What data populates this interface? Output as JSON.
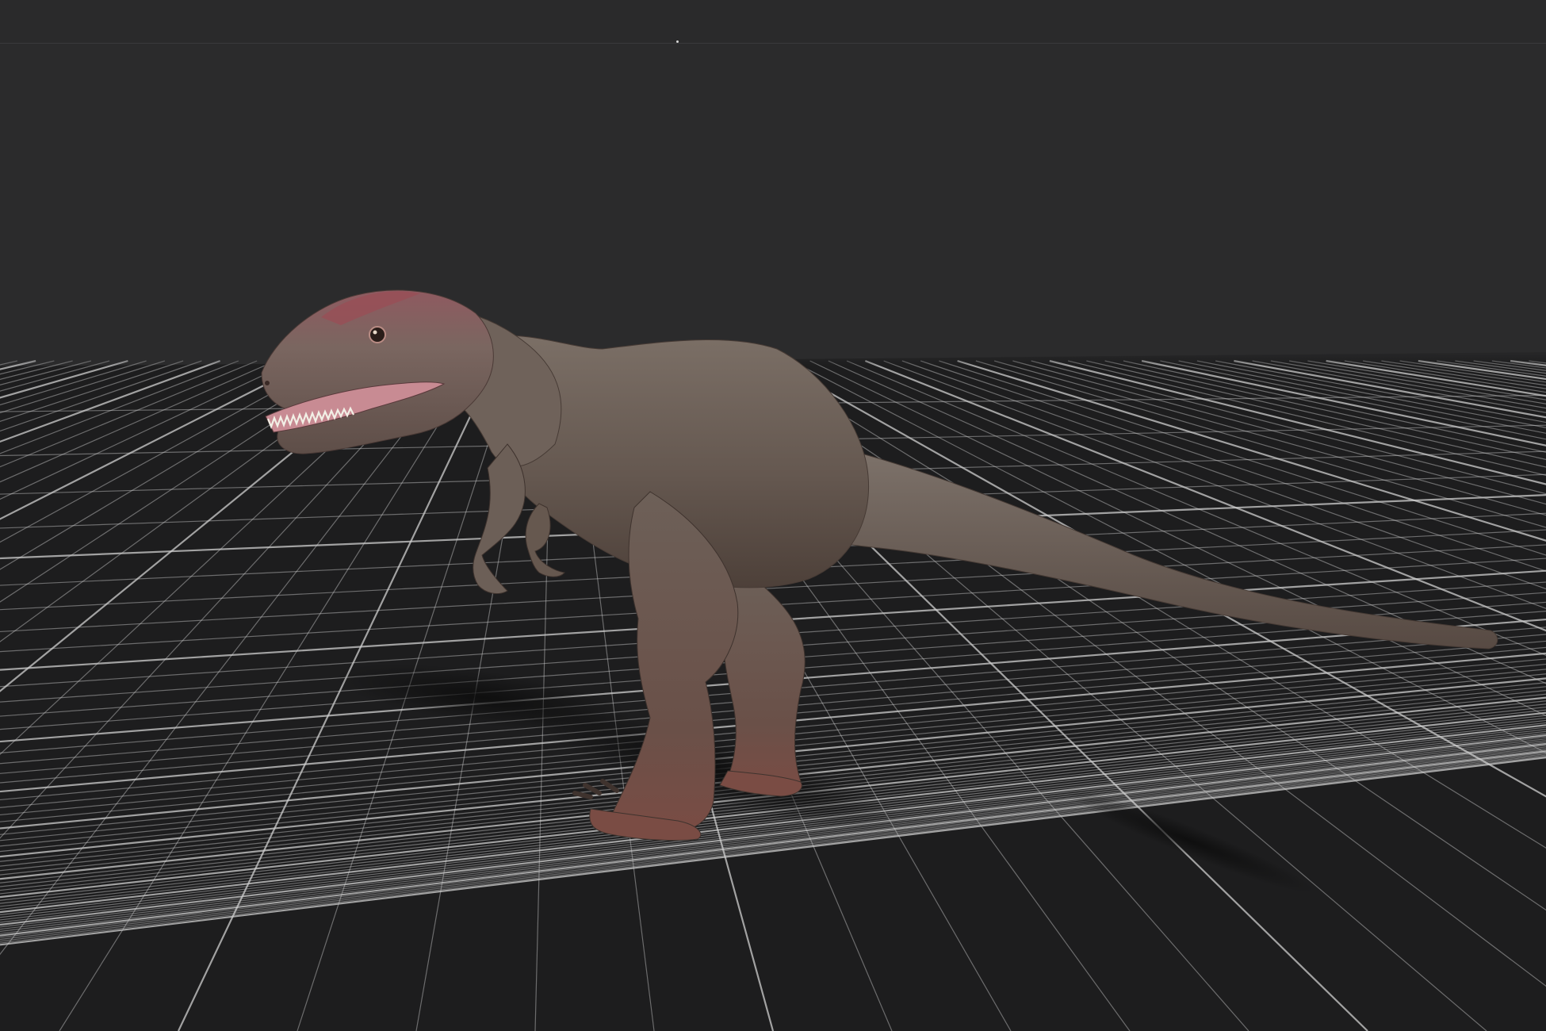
{
  "viewport": {
    "background_color": "#2b2b2c",
    "grid_color": "#cfcfcf",
    "floor_color": "#1d1d1e",
    "model": "theropod-dinosaur",
    "model_skin_color": "#6e6058",
    "model_accent_color": "#8a5058",
    "shadow": true
  }
}
